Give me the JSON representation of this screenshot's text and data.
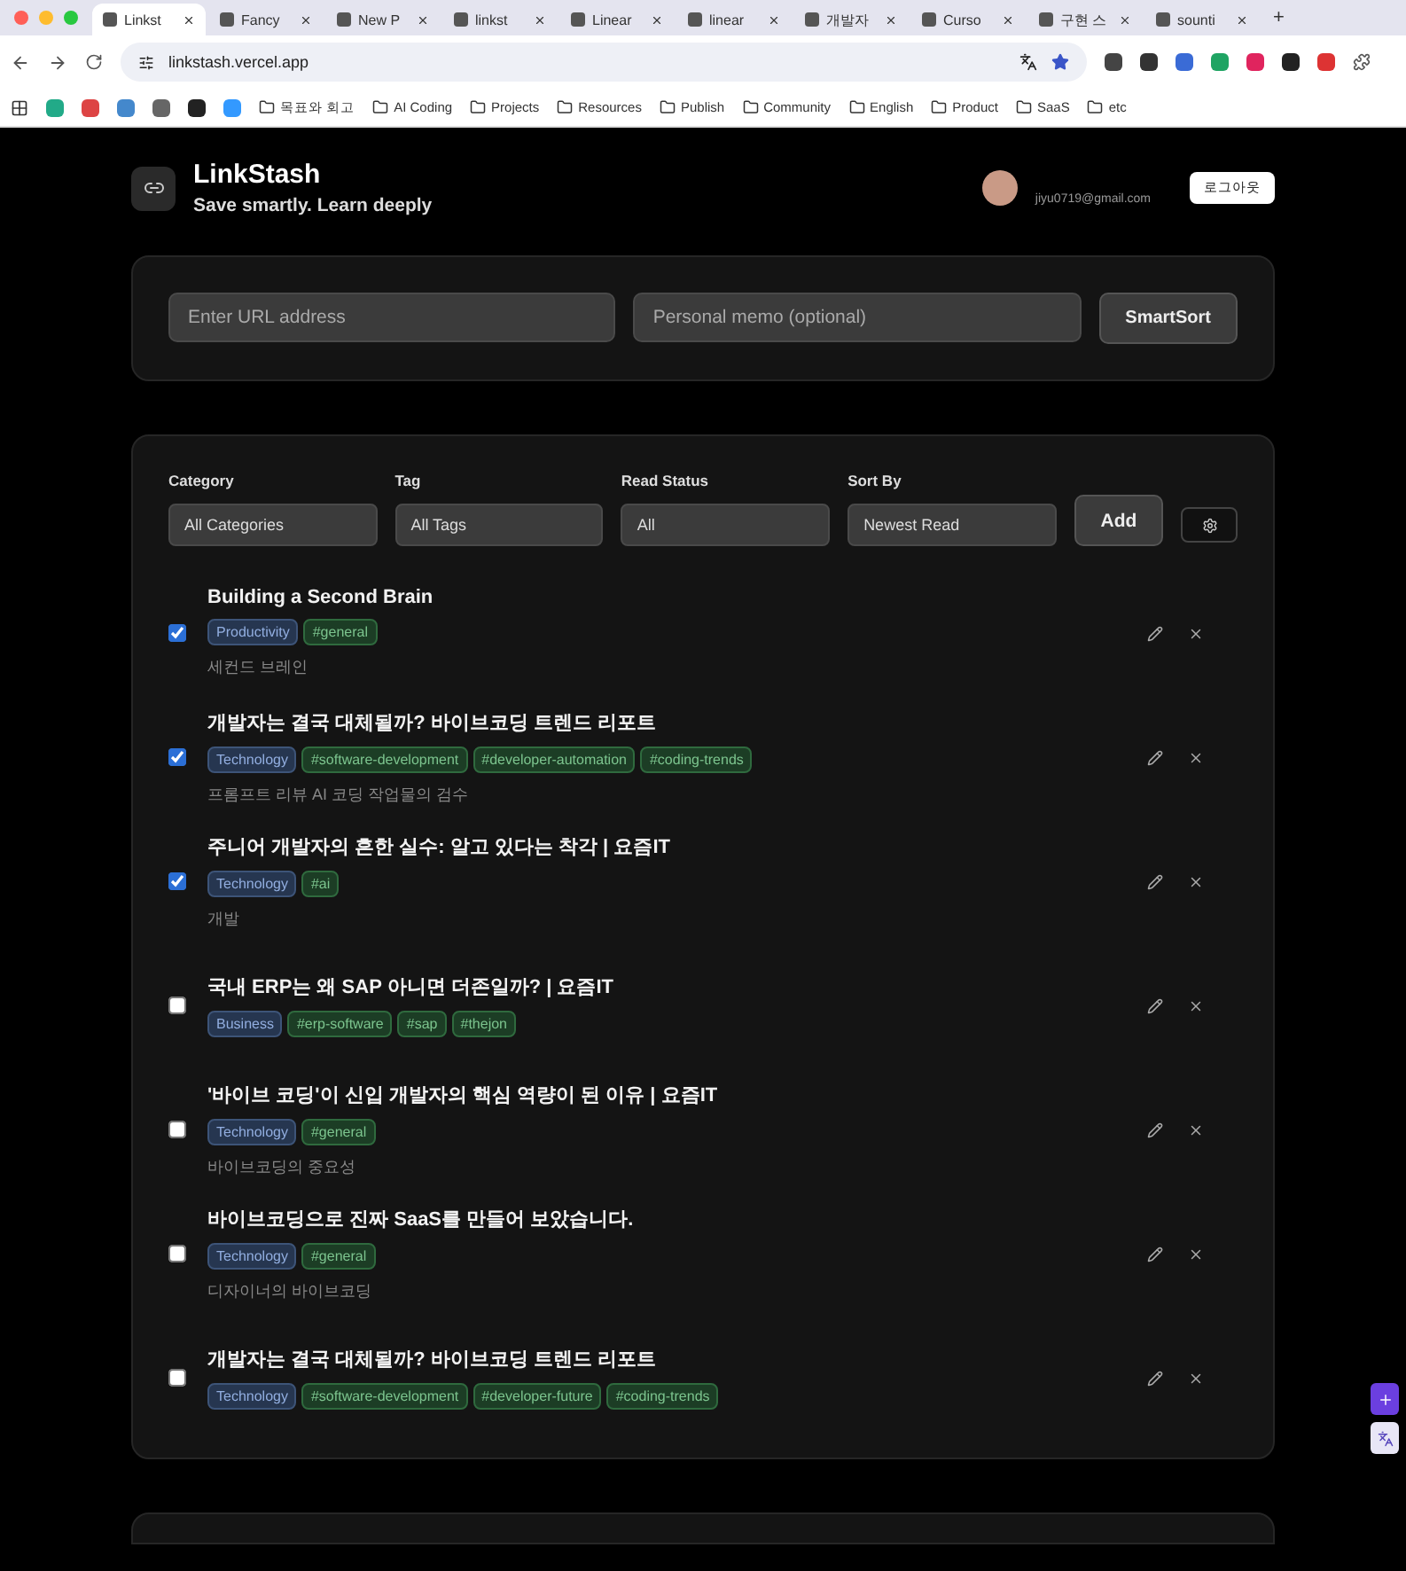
{
  "browser": {
    "tabs": [
      {
        "label": "Linkst",
        "selected": true
      },
      {
        "label": "Fancy",
        "selected": false
      },
      {
        "label": "New P",
        "selected": false
      },
      {
        "label": "linkst",
        "selected": false
      },
      {
        "label": "Linear",
        "selected": false
      },
      {
        "label": "linear",
        "selected": false
      },
      {
        "label": "개발자",
        "selected": false
      },
      {
        "label": "Curso",
        "selected": false
      },
      {
        "label": "구현 스",
        "selected": false
      },
      {
        "label": "sounti",
        "selected": false
      }
    ],
    "new_tab": "+",
    "address": "linkstash.vercel.app",
    "bookmarks": [
      "목표와 회고",
      "AI Coding",
      "Projects",
      "Resources",
      "Publish",
      "Community",
      "English",
      "Product",
      "SaaS",
      "etc"
    ]
  },
  "header": {
    "title": "LinkStash",
    "subtitle": "Save smartly. Learn deeply",
    "email": "jiyu0719@gmail.com",
    "logout": "로그아웃"
  },
  "add_form": {
    "url_placeholder": "Enter URL address",
    "memo_placeholder": "Personal memo (optional)",
    "button": "SmartSort"
  },
  "filters": [
    {
      "label": "Category",
      "value": "All Categories"
    },
    {
      "label": "Tag",
      "value": "All Tags"
    },
    {
      "label": "Read Status",
      "value": "All"
    },
    {
      "label": "Sort By",
      "value": "Newest Read"
    }
  ],
  "add_button": "Add",
  "links": [
    {
      "checked": true,
      "title": "Building a Second Brain",
      "tags": [
        {
          "kind": "category",
          "label": "Productivity"
        },
        {
          "kind": "tag",
          "label": "#general"
        }
      ],
      "memo": "세컨드 브레인"
    },
    {
      "checked": true,
      "title": "개발자는 결국 대체될까? 바이브코딩 트렌드 리포트",
      "tags": [
        {
          "kind": "category",
          "label": "Technology"
        },
        {
          "kind": "tag",
          "label": "#software-development"
        },
        {
          "kind": "tag",
          "label": "#developer-automation"
        },
        {
          "kind": "tag",
          "label": "#coding-trends"
        }
      ],
      "memo": "프롬프트 리뷰 AI 코딩 작업물의 검수"
    },
    {
      "checked": true,
      "title": "주니어 개발자의 흔한 실수: 알고 있다는 착각 | 요즘IT",
      "tags": [
        {
          "kind": "category",
          "label": "Technology"
        },
        {
          "kind": "tag",
          "label": "#ai"
        }
      ],
      "memo": "개발"
    },
    {
      "checked": false,
      "title": "국내 ERP는 왜 SAP 아니면 더존일까? | 요즘IT",
      "tags": [
        {
          "kind": "category",
          "label": "Business"
        },
        {
          "kind": "tag",
          "label": "#erp-software"
        },
        {
          "kind": "tag",
          "label": "#sap"
        },
        {
          "kind": "tag",
          "label": "#thejon"
        }
      ]
    },
    {
      "checked": false,
      "title": "'바이브 코딩'이 신입 개발자의 핵심 역량이 된 이유 | 요즘IT",
      "tags": [
        {
          "kind": "category",
          "label": "Technology"
        },
        {
          "kind": "tag",
          "label": "#general"
        }
      ],
      "memo": "바이브코딩의 중요성"
    },
    {
      "checked": false,
      "title": "바이브코딩으로 진짜 SaaS를 만들어 보았습니다.",
      "tags": [
        {
          "kind": "category",
          "label": "Technology"
        },
        {
          "kind": "tag",
          "label": "#general"
        }
      ],
      "memo": "디자이너의 바이브코딩"
    },
    {
      "checked": false,
      "title": "개발자는 결국 대체될까? 바이브코딩 트렌드 리포트",
      "tags": [
        {
          "kind": "category",
          "label": "Technology"
        },
        {
          "kind": "tag",
          "label": "#software-development"
        },
        {
          "kind": "tag",
          "label": "#developer-future"
        },
        {
          "kind": "tag",
          "label": "#coding-trends"
        }
      ]
    }
  ]
}
